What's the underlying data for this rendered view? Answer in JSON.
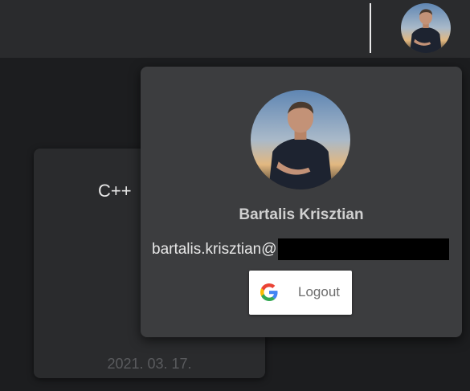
{
  "header": {
    "avatar_icon": "user-avatar"
  },
  "card": {
    "title": "C++",
    "date": "2021. 03. 17."
  },
  "user_menu": {
    "name": "Bartalis Krisztian",
    "email_prefix": "bartalis.krisztian@",
    "logout_label": "Logout",
    "logout_icon": "google-icon"
  },
  "colors": {
    "page_background": "#1c1d1f",
    "topbar_background": "#2a2b2d",
    "card_background": "#2a2b2d",
    "popup_background": "#3c3d3f",
    "name_text": "#d0d0d0",
    "email_text": "#e8e8e8",
    "date_text": "#5a5b5e",
    "redaction": "#000000"
  }
}
